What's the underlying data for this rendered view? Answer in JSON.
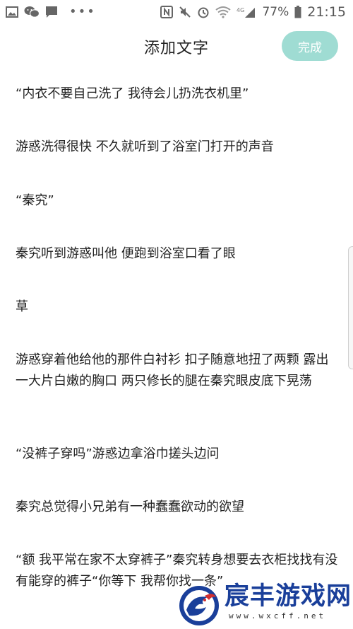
{
  "status_bar": {
    "battery": "77%",
    "time": "21:15",
    "icons": [
      "gallery-icon",
      "wechat-icon",
      "message-icon",
      "nfc-icon",
      "mute-icon",
      "alarm-icon",
      "wifi-icon",
      "signal-icon",
      "battery-icon"
    ],
    "network_label": "4G"
  },
  "header": {
    "title": "添加文字",
    "done_label": "完成",
    "done_color": "#9fdcd3"
  },
  "paragraphs": [
    "“内衣不要自己洗了 我待会儿扔洗衣机里”",
    "游惑洗得很快 不久就听到了浴室门打开的声音",
    "“秦究”",
    "秦究听到游惑叫他 便跑到浴室口看了眼",
    "草",
    "游惑穿着他给他的那件白衬衫  扣子随意地扭了两颗 露出一大片白嫩的胸口 两只修长的腿在秦究眼皮底下晃荡",
    "“没裤子穿吗”游惑边拿浴巾搓头边问",
    "秦究总觉得小兄弟有一种蠢蠢欲动的欲望",
    "“额 我平常在家不太穿裤子”秦究转身想要去衣柜找找有没有能穿的裤子“你等下 我帮你找一条”"
  ],
  "watermark": {
    "name": "宸丰游戏网",
    "url": "www.wxcff.net"
  }
}
